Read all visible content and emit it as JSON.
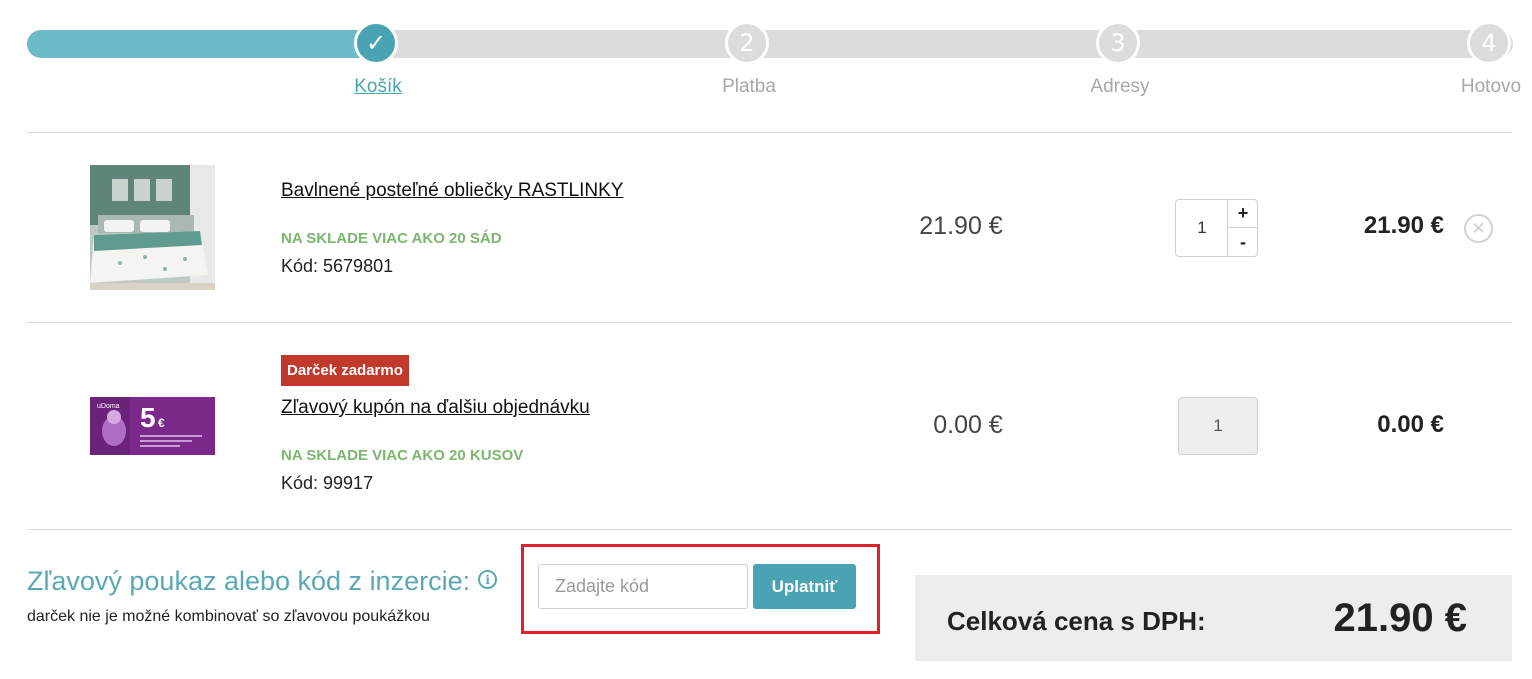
{
  "steps": [
    {
      "number": "✓",
      "label": "Košík",
      "active": true
    },
    {
      "number": "2",
      "label": "Platba",
      "active": false
    },
    {
      "number": "3",
      "label": "Adresy",
      "active": false
    },
    {
      "number": "4",
      "label": "Hotovo",
      "active": false
    }
  ],
  "cart": {
    "items": [
      {
        "title": "Bavlnené posteľné obliečky RASTLINKY",
        "stock": "NA SKLADE VIAC AKO 20 SÁD",
        "code": "Kód: 5679801",
        "unit_price": "21.90 €",
        "quantity": "1",
        "total": "21.90 €",
        "quantity_controls": [
          "+",
          "-"
        ],
        "remove_icon": "remove-circle-icon"
      },
      {
        "badge": "Darček zadarmo",
        "title": "Zľavový kupón na ďalšiu objednávku",
        "stock": "NA SKLADE VIAC AKO 20 KUSOV",
        "code": "Kód: 99917",
        "unit_price": "0.00 €",
        "quantity": "1",
        "total": "0.00 €",
        "coupon_image": {
          "brand": "uDoma",
          "amount": "5",
          "currency": "€"
        }
      }
    ]
  },
  "voucher": {
    "title": "Zľavový poukaz alebo kód z inzercie:",
    "info_icon": "i",
    "note": "darček nie je možné kombinovať so zľavovou poukážkou",
    "placeholder": "Zadajte kód",
    "value": "",
    "apply_label": "Uplatniť"
  },
  "summary": {
    "label": "Celková cena s DPH:",
    "total": "21.90 €"
  },
  "colors": {
    "accent": "#4aa3b3",
    "progress_fill": "#6bbcc8",
    "stock_green": "#7cb66e",
    "badge_red": "#c0392b",
    "highlight_red": "#e0202a"
  }
}
